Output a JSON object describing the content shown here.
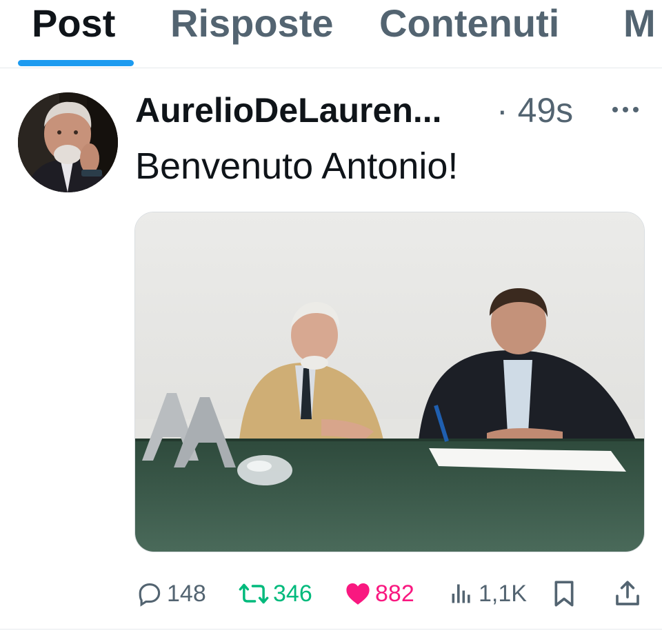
{
  "tabs": [
    {
      "label": "Post",
      "active": true
    },
    {
      "label": "Risposte",
      "active": false
    },
    {
      "label": "Contenuti",
      "active": false
    },
    {
      "label": "M",
      "active": false
    }
  ],
  "post": {
    "author": "AurelioDeLauren...",
    "separator": "·",
    "time": "49s",
    "text": "Benvenuto Antonio!",
    "more_icon": "more-horizontal-icon",
    "media_alt": "Two men seated at a green conference table, one signing a document"
  },
  "actions": {
    "replies": "148",
    "reposts": "346",
    "likes": "882",
    "views": "1,1K"
  },
  "colors": {
    "accent": "#1d9bf0",
    "muted": "#536471",
    "repost": "#00ba7c",
    "like": "#f91880"
  }
}
